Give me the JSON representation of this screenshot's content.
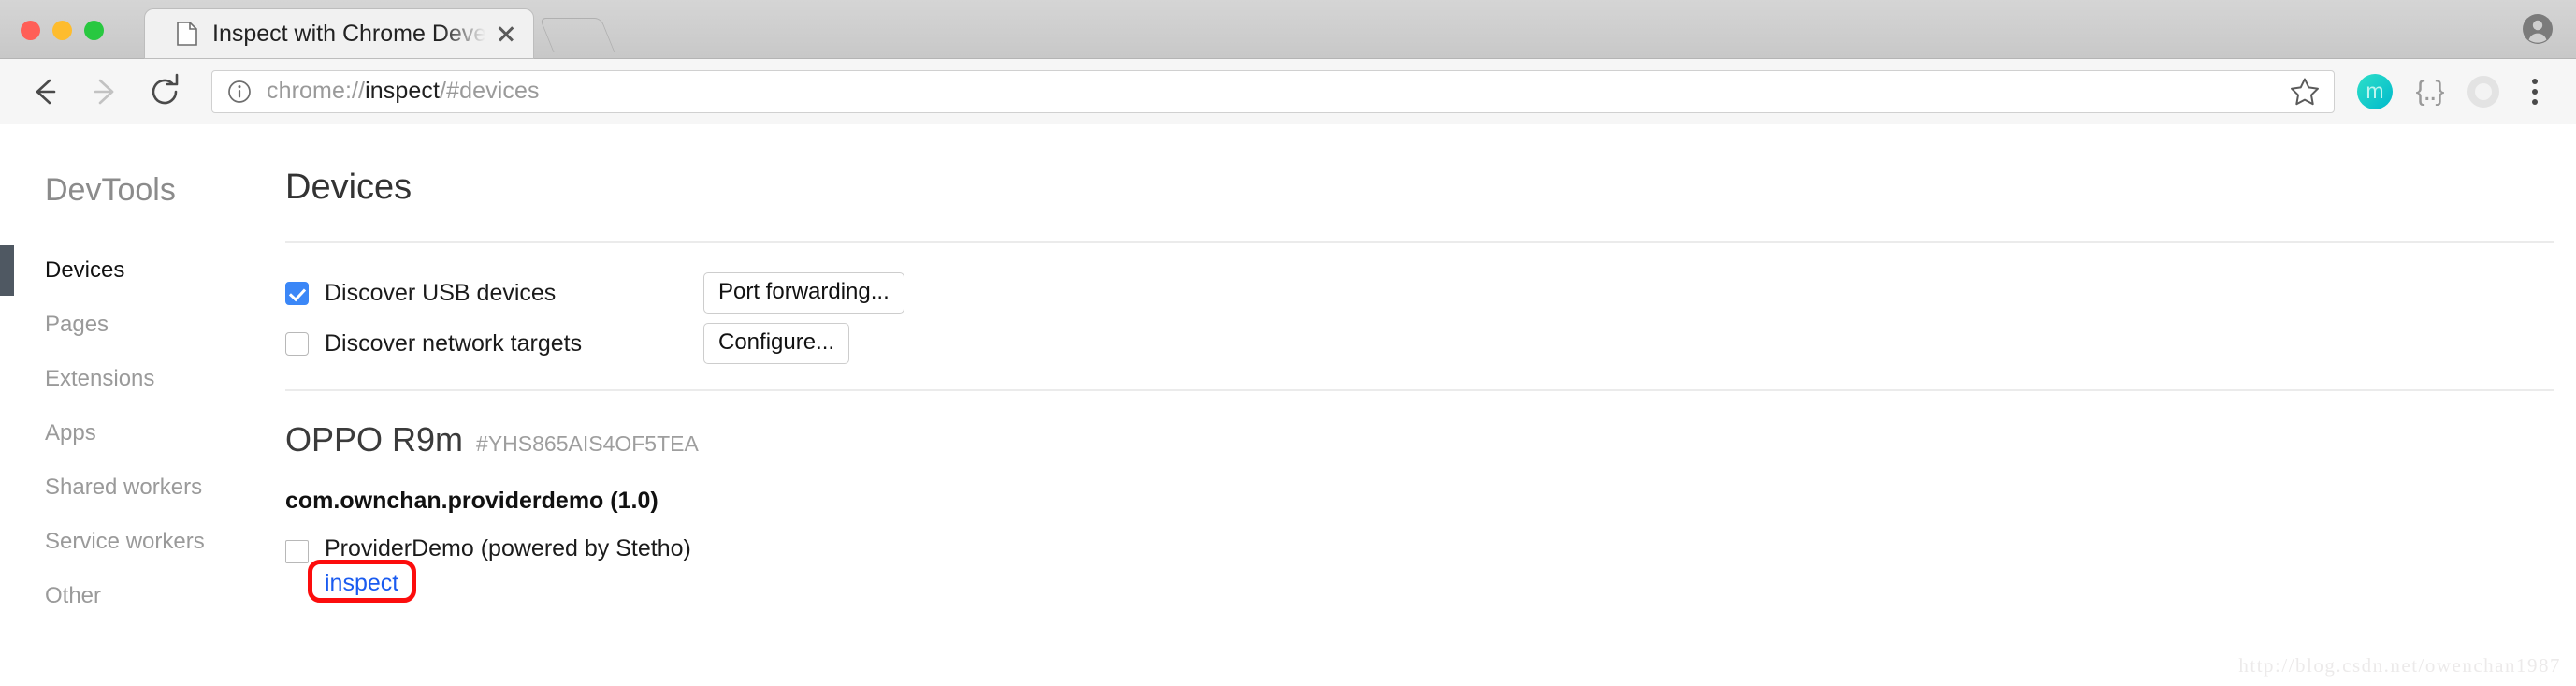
{
  "window": {
    "traffic_lights": [
      "close",
      "minimize",
      "maximize"
    ],
    "account_icon": "account-circle-icon"
  },
  "tab": {
    "title": "Inspect with Chrome Developer",
    "favicon": "page-icon",
    "close_icon": "close-icon",
    "new_tab_label": "+"
  },
  "toolbar": {
    "back_icon": "arrow-left-icon",
    "forward_icon": "arrow-right-icon",
    "reload_icon": "reload-icon",
    "security_icon": "info-circle-icon",
    "url_prefix": "chrome://",
    "url_strong": "inspect",
    "url_suffix": "/#devices",
    "url_full": "chrome://inspect/#devices",
    "bookmark_icon": "star-icon",
    "extensions": [
      {
        "name": "avatar-m-icon",
        "label": "m"
      },
      {
        "name": "json-formatter-icon",
        "label": "{..}"
      },
      {
        "name": "ring-extension-icon",
        "label": ""
      }
    ],
    "menu_icon": "kebab-menu-icon"
  },
  "sidebar": {
    "brand": "DevTools",
    "items": [
      {
        "label": "Devices",
        "selected": true
      },
      {
        "label": "Pages",
        "selected": false
      },
      {
        "label": "Extensions",
        "selected": false
      },
      {
        "label": "Apps",
        "selected": false
      },
      {
        "label": "Shared workers",
        "selected": false
      },
      {
        "label": "Service workers",
        "selected": false
      },
      {
        "label": "Other",
        "selected": false
      }
    ]
  },
  "main": {
    "title": "Devices",
    "discovery": {
      "usb": {
        "label": "Discover USB devices",
        "checked": true,
        "button": "Port forwarding..."
      },
      "network": {
        "label": "Discover network targets",
        "checked": false,
        "button": "Configure..."
      }
    },
    "device": {
      "name": "OPPO R9m",
      "serial": "#YHS865AIS4OF5TEA",
      "package": "com.ownchan.providerdemo (1.0)",
      "target": {
        "title": "ProviderDemo (powered by Stetho)",
        "checked": false,
        "inspect_label": "inspect",
        "highlighted": true
      }
    }
  },
  "watermark": "http://blog.csdn.net/owenchan1987",
  "colors": {
    "accent_blue": "#3b87f7",
    "link_blue": "#1a5bf0",
    "annotation_red": "#fc0d0d",
    "selected_bar": "#4f5862"
  }
}
